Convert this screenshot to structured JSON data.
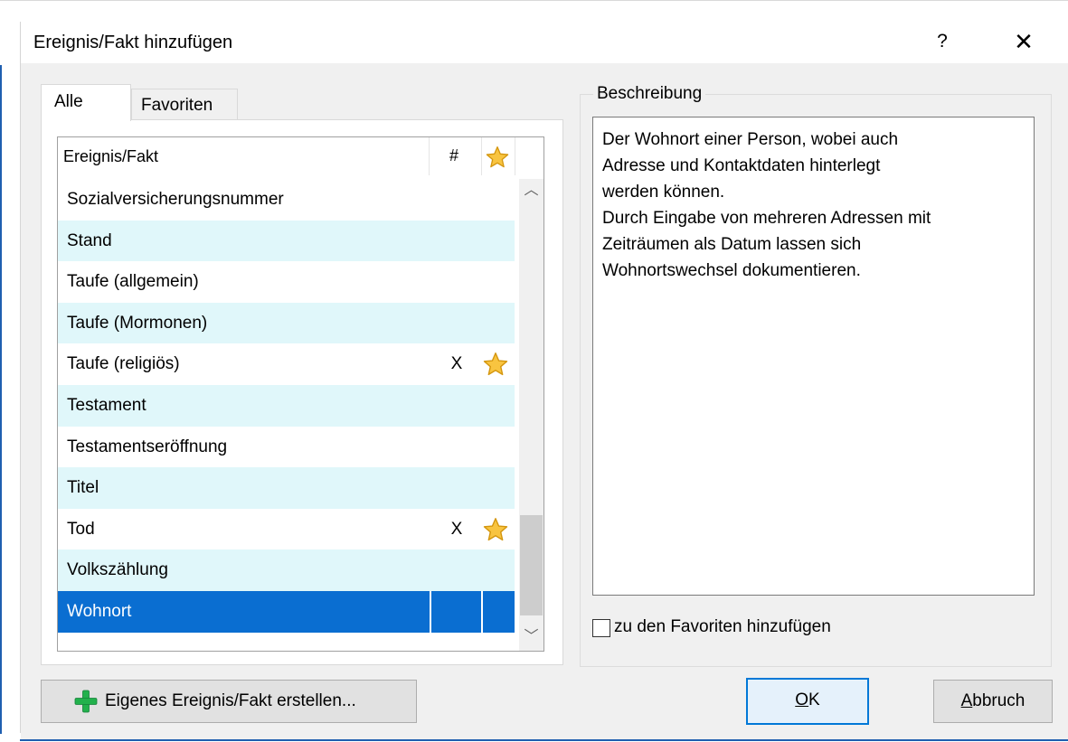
{
  "window": {
    "title": "Ereignis/Fakt hinzufügen",
    "help_label": "?",
    "close_label": "✕"
  },
  "tabs": [
    {
      "label": "Alle",
      "active": true
    },
    {
      "label": "Favoriten",
      "active": false
    }
  ],
  "list": {
    "columns": {
      "name": "Ereignis/Fakt",
      "count": "#",
      "favorite_icon": "star-icon"
    },
    "rows": [
      {
        "name": "Sozialversicherungsnummer",
        "count": "",
        "favorite": false
      },
      {
        "name": "Stand",
        "count": "",
        "favorite": false
      },
      {
        "name": "Taufe (allgemein)",
        "count": "",
        "favorite": false
      },
      {
        "name": "Taufe (Mormonen)",
        "count": "",
        "favorite": false
      },
      {
        "name": "Taufe (religiös)",
        "count": "X",
        "favorite": true
      },
      {
        "name": "Testament",
        "count": "",
        "favorite": false
      },
      {
        "name": "Testamentseröffnung",
        "count": "",
        "favorite": false
      },
      {
        "name": "Titel",
        "count": "",
        "favorite": false
      },
      {
        "name": "Tod",
        "count": "X",
        "favorite": true
      },
      {
        "name": "Volkszählung",
        "count": "",
        "favorite": false
      },
      {
        "name": "Wohnort",
        "count": "",
        "favorite": false,
        "selected": true
      }
    ],
    "colors": {
      "alt_row": "#e0f7fa",
      "selected": "#0a6ed1"
    }
  },
  "description": {
    "legend": "Beschreibung",
    "text": "Der Wohnort einer Person, wobei auch\nAdresse und Kontaktdaten hinterlegt\nwerden können.\nDurch Eingabe von mehreren Adressen mit\nZeiträumen als Datum lassen sich\nWohnortswechsel dokumentieren.",
    "add_favorite_label": "zu den Favoriten hinzufügen",
    "add_favorite_checked": false
  },
  "buttons": {
    "create_label": "Eigenes Ereignis/Fakt erstellen...",
    "create_icon": "plus-icon",
    "ok_label": "OK",
    "cancel_label": "Abbruch"
  }
}
